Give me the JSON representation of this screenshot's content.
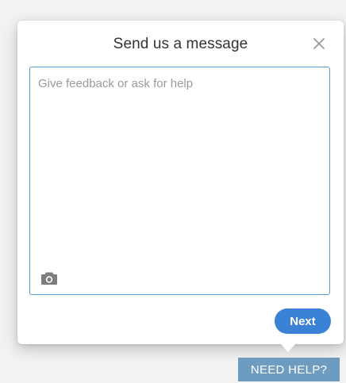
{
  "dialog": {
    "title": "Send us a message",
    "close_icon": "close-icon",
    "message": {
      "value": "",
      "placeholder": "Give feedback or ask for help"
    },
    "camera_icon": "camera-icon",
    "next_label": "Next"
  },
  "help_tab": {
    "label": "NEED HELP?"
  },
  "colors": {
    "accent": "#3b82d6",
    "input_border": "#5b9bd5",
    "help_tab_bg": "#6e9bc0",
    "background": "#f2f2f2"
  }
}
